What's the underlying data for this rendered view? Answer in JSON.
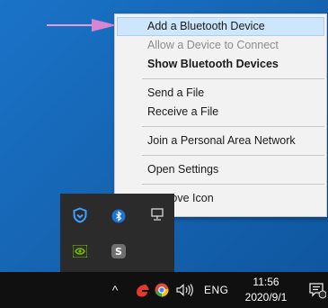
{
  "context_menu": {
    "items": [
      {
        "label": "Add a Bluetooth Device"
      },
      {
        "label": "Allow a Device to Connect"
      },
      {
        "label": "Show Bluetooth Devices"
      },
      {
        "label": "Send a File"
      },
      {
        "label": "Receive a File"
      },
      {
        "label": "Join a Personal Area Network"
      },
      {
        "label": "Open Settings"
      },
      {
        "label": "Remove Icon"
      }
    ]
  },
  "taskbar": {
    "chevron": "^",
    "language": "ENG",
    "time": "11:56",
    "date": "2020/9/1"
  },
  "tray_flyout_icons": [
    "shield-icon",
    "bluetooth-icon",
    "network-icon",
    "nvidia-icon",
    "s-app-icon"
  ],
  "taskbar_icons": [
    "chevron-up-icon",
    "red-app-icon",
    "chrome-icon",
    "volume-icon",
    "notification-icon"
  ],
  "colors": {
    "highlight": "#cde6fb",
    "arrow": "#d98ad6",
    "taskbar": "#101010",
    "desktop": "#1568b8"
  }
}
